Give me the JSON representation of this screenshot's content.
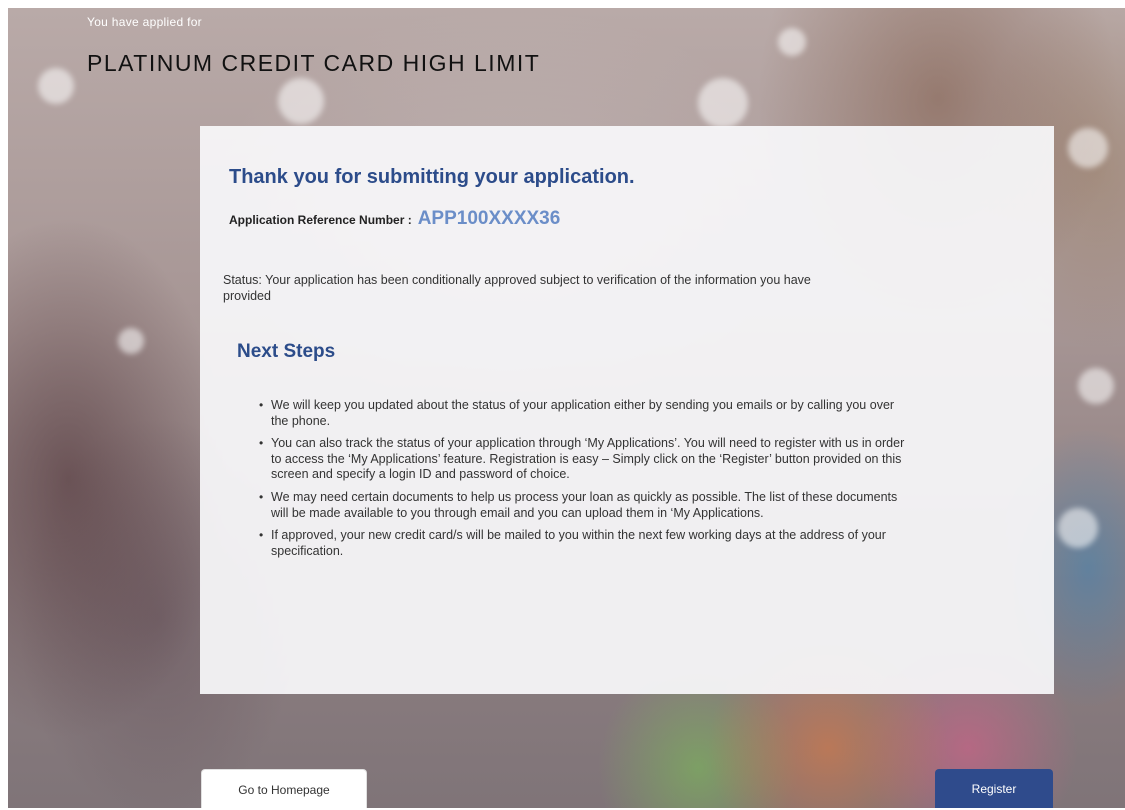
{
  "header": {
    "applied_label": "You have applied for",
    "product_title": "PLATINUM CREDIT CARD HIGH LIMIT"
  },
  "confirmation": {
    "thank_you": "Thank you for submitting your application.",
    "reference_label": "Application Reference Number :",
    "reference_number": "APP100XXXX36",
    "status_text": "Status: Your application has been conditionally approved subject to verification of the information you have provided"
  },
  "next_steps": {
    "heading": "Next Steps",
    "items": [
      "We will keep you updated about the status of your application either by sending you emails or by calling you over the phone.",
      "You can also track the status of your application through ‘My Applications’. You will need to register with us in order to access the ‘My Applications’ feature. Registration is easy – Simply click on the ‘Register’ button provided on this screen and specify a login ID and password of choice.",
      "We may need certain documents to help us process your loan as quickly as possible. The list of these documents will be made available to you through email and you can upload them in ‘My Applications.",
      "If approved, your new credit card/s will be mailed to you within the next few working days at the address of your specification."
    ]
  },
  "actions": {
    "homepage_label": "Go to Homepage",
    "register_label": "Register"
  },
  "colors": {
    "heading_blue": "#2c4c8a",
    "reference_blue": "#6b8ec8",
    "button_blue": "#2f4b8c"
  },
  "icons": {
    "list_bullet": "bullet-icon"
  }
}
